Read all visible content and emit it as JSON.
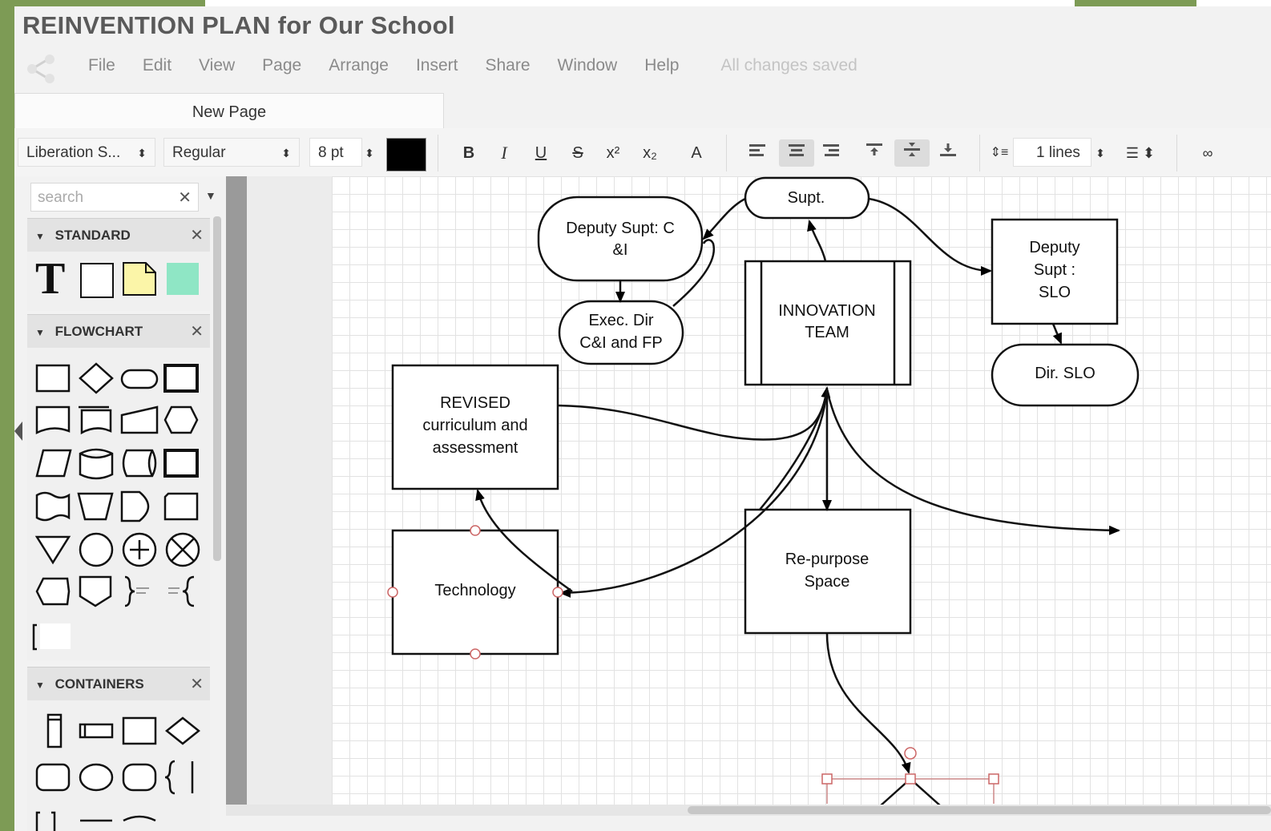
{
  "document": {
    "title": "REINVENTION PLAN for Our School"
  },
  "menu": {
    "items": [
      "File",
      "Edit",
      "View",
      "Page",
      "Arrange",
      "Insert",
      "Share",
      "Window",
      "Help"
    ],
    "status": "All changes saved"
  },
  "tabs": [
    "New Page"
  ],
  "toolbar": {
    "font_family": "Liberation S...",
    "font_style": "Regular",
    "font_size": "8 pt",
    "font_color": "#000000",
    "bold": "B",
    "italic": "I",
    "underline": "U",
    "strikethrough": "S",
    "superscript": "x²",
    "subscript": "x₂",
    "clear_format": "A",
    "line_spacing": "1 lines"
  },
  "sidebar": {
    "search_placeholder": "search",
    "sections": [
      {
        "title": "STANDARD"
      },
      {
        "title": "FLOWCHART"
      },
      {
        "title": "CONTAINERS"
      }
    ],
    "standard_text_shape": "T",
    "colors": {
      "note_fill": "#fbf5a8",
      "swatch_fill": "#8fe6c5"
    }
  },
  "diagram": {
    "nodes": {
      "supt": "Supt.",
      "deputy_ci_line1": "Deputy Supt: C",
      "deputy_ci_line2": "&I",
      "exec_dir_line1": "Exec. Dir",
      "exec_dir_line2": "C&I and FP",
      "innovation_line1": "INNOVATION",
      "innovation_line2": "TEAM",
      "deputy_slo_line1": "Deputy",
      "deputy_slo_line2": "Supt :",
      "deputy_slo_line3": "SLO",
      "dir_slo": "Dir. SLO",
      "revised_line1": "REVISED",
      "revised_line2": "curriculum and",
      "revised_line3": "assessment",
      "technology": "Technology",
      "repurpose_line1": "Re-purpose",
      "repurpose_line2": "Space"
    }
  }
}
